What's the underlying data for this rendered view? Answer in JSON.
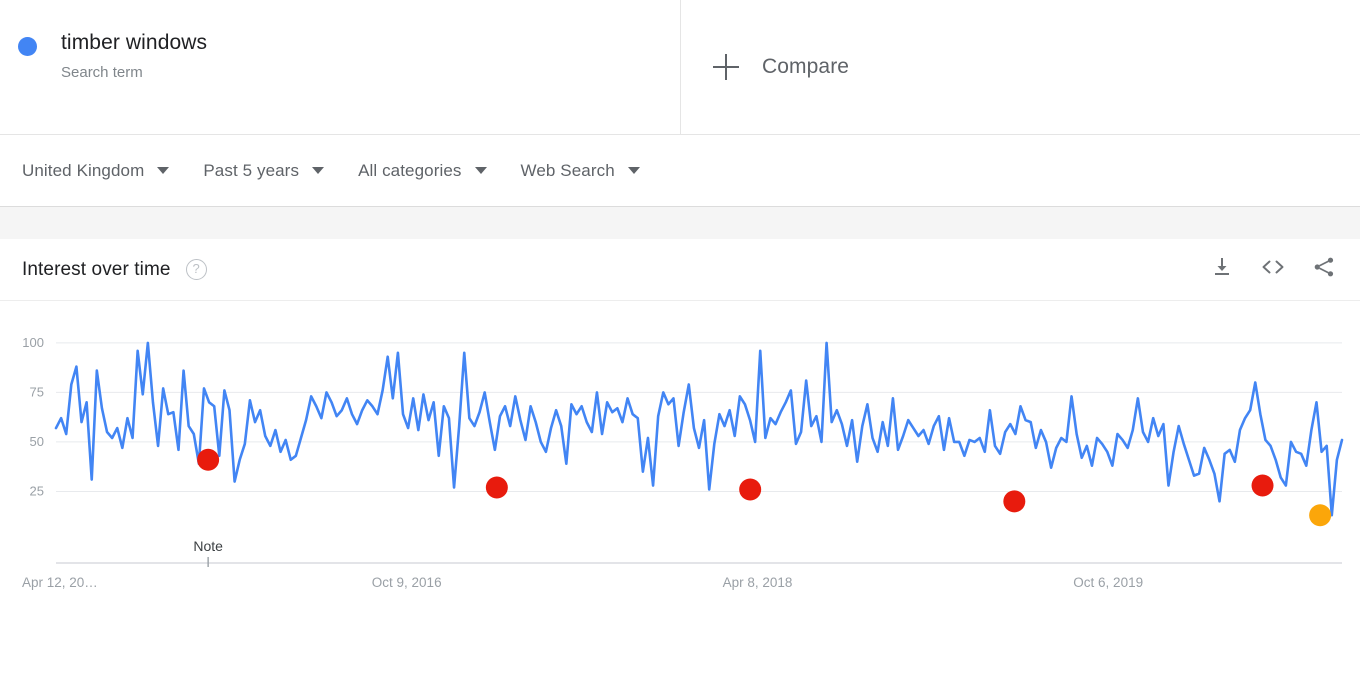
{
  "term": {
    "dot_color": "#4285F4",
    "title": "timber windows",
    "subtitle": "Search term"
  },
  "compare": {
    "label": "Compare",
    "icon": "plus-icon"
  },
  "filters": [
    {
      "label": "United Kingdom",
      "name": "location"
    },
    {
      "label": "Past 5 years",
      "name": "time-range"
    },
    {
      "label": "All categories",
      "name": "category"
    },
    {
      "label": "Web Search",
      "name": "search-type"
    }
  ],
  "card": {
    "title": "Interest over time",
    "help": "?",
    "actions": [
      {
        "name": "download-icon",
        "label": "Download CSV"
      },
      {
        "name": "embed-icon",
        "label": "Embed"
      },
      {
        "name": "share-icon",
        "label": "Share"
      }
    ]
  },
  "chart_data": {
    "type": "line",
    "title": "Interest over time",
    "xlabel": "",
    "ylabel": "",
    "ylim": [
      0,
      107
    ],
    "yticks": [
      25,
      50,
      75,
      100
    ],
    "grid": true,
    "legend": false,
    "line_color": "#4285F4",
    "xticks": [
      {
        "label": "Apr 12, 20…",
        "pos": 0.0
      },
      {
        "label": "Oct 9, 2016",
        "pos": 0.2727
      },
      {
        "label": "Oct 6, 2019",
        "pos": 0.8182
      },
      {
        "label": "Apr 8, 2018",
        "pos": 0.5455
      }
    ],
    "annotations": [
      {
        "label": "Note",
        "pos": 0.1183,
        "type": "axis-note"
      }
    ],
    "markers": [
      {
        "x": 0.1183,
        "y": 41,
        "color": "#E81B0D",
        "r": 11
      },
      {
        "x": 0.3428,
        "y": 27,
        "color": "#E81B0D",
        "r": 11
      },
      {
        "x": 0.5398,
        "y": 26,
        "color": "#E81B0D",
        "r": 11
      },
      {
        "x": 0.7452,
        "y": 20,
        "color": "#E81B0D",
        "r": 11
      },
      {
        "x": 0.9382,
        "y": 28,
        "color": "#E81B0D",
        "r": 11
      },
      {
        "x": 0.983,
        "y": 13,
        "color": "#FBA60A",
        "r": 11
      }
    ],
    "series": [
      {
        "name": "timber windows",
        "color": "#4285F4",
        "values": [
          57,
          62,
          54,
          79,
          88,
          60,
          70,
          31,
          86,
          67,
          55,
          52,
          57,
          47,
          62,
          52,
          96,
          74,
          100,
          70,
          48,
          77,
          64,
          65,
          46,
          86,
          58,
          54,
          39,
          77,
          70,
          68,
          43,
          76,
          66,
          30,
          41,
          49,
          71,
          60,
          66,
          53,
          48,
          56,
          45,
          51,
          41,
          43,
          52,
          61,
          73,
          68,
          62,
          75,
          70,
          63,
          66,
          72,
          64,
          59,
          66,
          71,
          68,
          64,
          76,
          93,
          72,
          95,
          64,
          57,
          72,
          56,
          74,
          61,
          70,
          43,
          68,
          62,
          27,
          58,
          95,
          62,
          58,
          65,
          75,
          60,
          46,
          63,
          68,
          58,
          73,
          61,
          51,
          68,
          60,
          50,
          45,
          57,
          66,
          58,
          39,
          69,
          64,
          68,
          60,
          55,
          75,
          54,
          70,
          65,
          67,
          60,
          72,
          64,
          62,
          35,
          52,
          28,
          63,
          75,
          69,
          72,
          48,
          65,
          79,
          57,
          47,
          61,
          26,
          49,
          64,
          58,
          66,
          53,
          73,
          69,
          61,
          50,
          96,
          52,
          62,
          59,
          65,
          70,
          76,
          49,
          55,
          81,
          58,
          63,
          50,
          100,
          60,
          66,
          59,
          48,
          61,
          40,
          58,
          69,
          52,
          45,
          60,
          48,
          72,
          46,
          53,
          61,
          57,
          53,
          56,
          49,
          58,
          63,
          46,
          62,
          50,
          50,
          43,
          51,
          50,
          52,
          45,
          66,
          48,
          44,
          55,
          59,
          54,
          68,
          61,
          60,
          47,
          56,
          50,
          37,
          47,
          52,
          50,
          73,
          54,
          42,
          48,
          38,
          52,
          49,
          45,
          38,
          54,
          51,
          47,
          56,
          72,
          55,
          50,
          62,
          53,
          59,
          28,
          45,
          58,
          49,
          41,
          33,
          34,
          47,
          41,
          34,
          20,
          44,
          46,
          40,
          56,
          62,
          66,
          80,
          64,
          51,
          48,
          41,
          32,
          28,
          50,
          45,
          44,
          38,
          56,
          70,
          45,
          48,
          13,
          41,
          51
        ]
      }
    ]
  }
}
